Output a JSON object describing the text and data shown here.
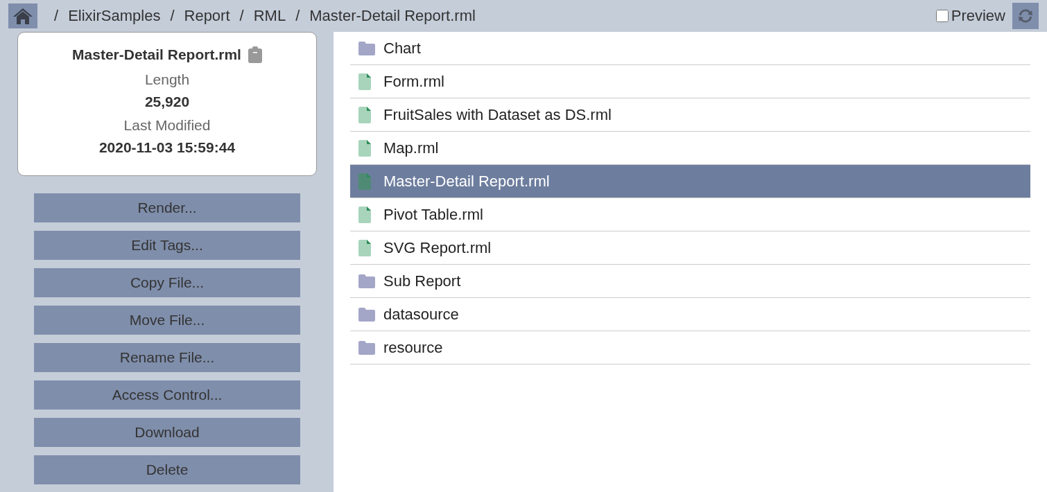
{
  "breadcrumb": [
    {
      "separator": "/",
      "label": "ElixirSamples"
    },
    {
      "separator": "/",
      "label": "Report"
    },
    {
      "separator": "/",
      "label": "RML"
    },
    {
      "separator": "/",
      "label": "Master-Detail Report.rml"
    }
  ],
  "preview": {
    "label": "Preview",
    "checked": false
  },
  "info": {
    "name": "Master-Detail Report.rml",
    "fields": [
      {
        "label": "Length",
        "value": "25,920"
      },
      {
        "label": "Last Modified",
        "value": "2020-11-03 15:59:44"
      }
    ]
  },
  "actions": [
    "Render...",
    "Edit Tags...",
    "Copy File...",
    "Move File...",
    "Rename File...",
    "Access Control...",
    "Download",
    "Delete"
  ],
  "entries": [
    {
      "kind": "folder",
      "name": "Chart",
      "selected": false
    },
    {
      "kind": "file",
      "name": "Form.rml",
      "selected": false
    },
    {
      "kind": "file",
      "name": "FruitSales with Dataset as DS.rml",
      "selected": false
    },
    {
      "kind": "file",
      "name": "Map.rml",
      "selected": false
    },
    {
      "kind": "file",
      "name": "Master-Detail Report.rml",
      "selected": true
    },
    {
      "kind": "file",
      "name": "Pivot Table.rml",
      "selected": false
    },
    {
      "kind": "file",
      "name": "SVG Report.rml",
      "selected": false
    },
    {
      "kind": "folder",
      "name": "Sub Report",
      "selected": false
    },
    {
      "kind": "folder",
      "name": "datasource",
      "selected": false
    },
    {
      "kind": "folder",
      "name": "resource",
      "selected": false
    }
  ]
}
